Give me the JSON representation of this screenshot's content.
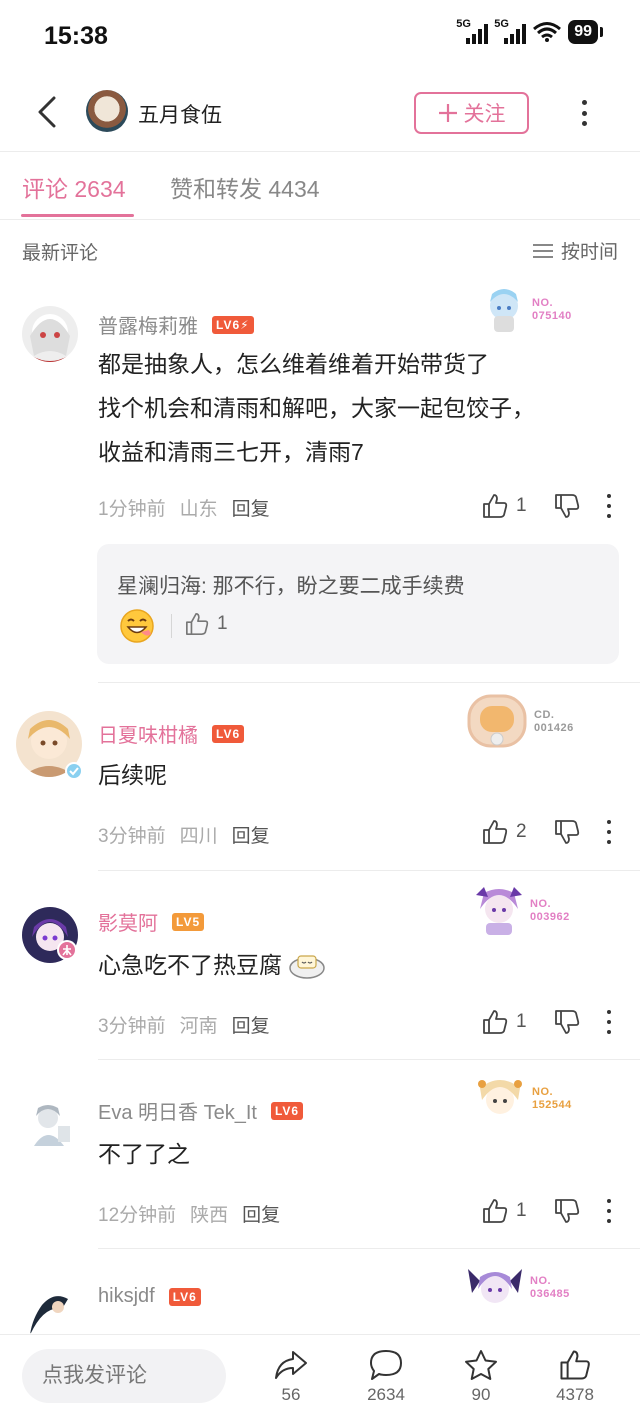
{
  "status_bar": {
    "time": "15:38",
    "signal1_label": "5G",
    "signal2_label": "5G",
    "battery": "99"
  },
  "nav": {
    "author_name": "五月食伍",
    "follow_label": "关注",
    "accent_color": "#e3729a"
  },
  "tabs": [
    {
      "label": "评论 2634",
      "active": true
    },
    {
      "label": "赞和转发 4434",
      "active": false
    }
  ],
  "sort": {
    "title": "最新评论",
    "button_label": "按时间"
  },
  "comments": [
    {
      "name": "普露梅莉雅",
      "name_color": "#8a8a8a",
      "level": "LV6",
      "level_color": "#f05a3a",
      "level_flash": true,
      "badge_no": "NO.\n075140",
      "badge_color": "#e27fc4",
      "text_lines": [
        "都是抽象人，怎么维着维着开始带货了",
        "找个机会和清雨和解吧，大家一起包饺子，",
        "收益和清雨三七开，清雨7"
      ],
      "time": "1分钟前",
      "location": "山东",
      "reply_label": "回复",
      "likes": "1"
    },
    {
      "name": "日夏味柑橘",
      "name_color": "#e3729a",
      "level": "LV6",
      "level_color": "#f05a3a",
      "badge_no": "CD.\n001426",
      "badge_color": "#9a9a9a",
      "text_lines": [
        "后续呢"
      ],
      "time": "3分钟前",
      "location": "四川",
      "reply_label": "回复",
      "likes": "2"
    },
    {
      "name": "影莫阿",
      "name_color": "#e3729a",
      "level": "LV5",
      "level_color": "#f39a3a",
      "badge_no": "NO.\n003962",
      "badge_color": "#e27fc4",
      "text_lines": [
        "心急吃不了热豆腐"
      ],
      "time": "3分钟前",
      "location": "河南",
      "reply_label": "回复",
      "likes": "1"
    },
    {
      "name": "Eva 明日香 Tek_It",
      "name_color": "#8a8a8a",
      "level": "LV6",
      "level_color": "#f05a3a",
      "badge_no": "NO.\n152544",
      "badge_color": "#e8a040",
      "text_lines": [
        "不了了之"
      ],
      "time": "12分钟前",
      "location": "陕西",
      "reply_label": "回复",
      "likes": "1"
    },
    {
      "name": "hiksjdf",
      "name_color": "#8a8a8a",
      "level": "LV6",
      "level_color": "#f05a3a",
      "badge_no": "NO.\n036485",
      "badge_color": "#e27fc4"
    }
  ],
  "sub_reply": {
    "text": "星澜归海: 那不行，盼之要二成手续费",
    "likes": "1"
  },
  "bottom_bar": {
    "input_placeholder": "点我发评论",
    "share_count": "56",
    "comment_count": "2634",
    "favorite_count": "90",
    "like_count": "4378"
  }
}
